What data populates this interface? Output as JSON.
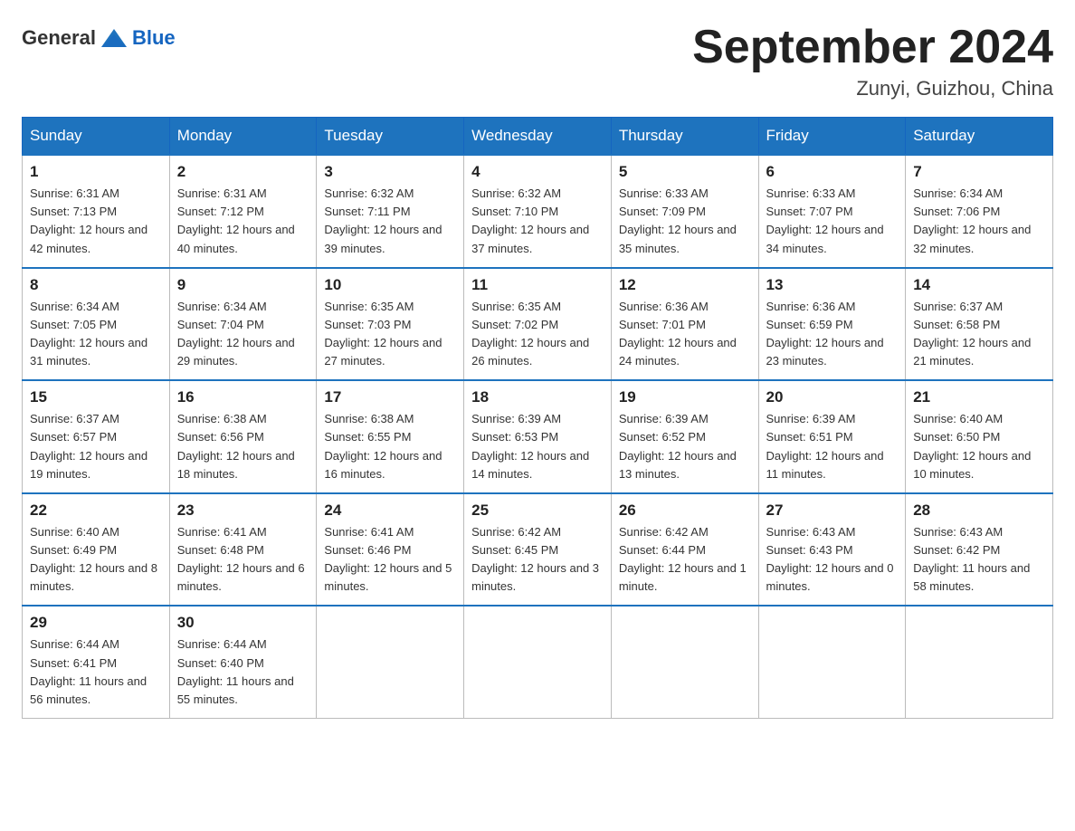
{
  "header": {
    "logo_general": "General",
    "logo_blue": "Blue",
    "title": "September 2024",
    "location": "Zunyi, Guizhou, China"
  },
  "days_of_week": [
    "Sunday",
    "Monday",
    "Tuesday",
    "Wednesday",
    "Thursday",
    "Friday",
    "Saturday"
  ],
  "weeks": [
    [
      {
        "day": "1",
        "sunrise": "6:31 AM",
        "sunset": "7:13 PM",
        "daylight": "12 hours and 42 minutes."
      },
      {
        "day": "2",
        "sunrise": "6:31 AM",
        "sunset": "7:12 PM",
        "daylight": "12 hours and 40 minutes."
      },
      {
        "day": "3",
        "sunrise": "6:32 AM",
        "sunset": "7:11 PM",
        "daylight": "12 hours and 39 minutes."
      },
      {
        "day": "4",
        "sunrise": "6:32 AM",
        "sunset": "7:10 PM",
        "daylight": "12 hours and 37 minutes."
      },
      {
        "day": "5",
        "sunrise": "6:33 AM",
        "sunset": "7:09 PM",
        "daylight": "12 hours and 35 minutes."
      },
      {
        "day": "6",
        "sunrise": "6:33 AM",
        "sunset": "7:07 PM",
        "daylight": "12 hours and 34 minutes."
      },
      {
        "day": "7",
        "sunrise": "6:34 AM",
        "sunset": "7:06 PM",
        "daylight": "12 hours and 32 minutes."
      }
    ],
    [
      {
        "day": "8",
        "sunrise": "6:34 AM",
        "sunset": "7:05 PM",
        "daylight": "12 hours and 31 minutes."
      },
      {
        "day": "9",
        "sunrise": "6:34 AM",
        "sunset": "7:04 PM",
        "daylight": "12 hours and 29 minutes."
      },
      {
        "day": "10",
        "sunrise": "6:35 AM",
        "sunset": "7:03 PM",
        "daylight": "12 hours and 27 minutes."
      },
      {
        "day": "11",
        "sunrise": "6:35 AM",
        "sunset": "7:02 PM",
        "daylight": "12 hours and 26 minutes."
      },
      {
        "day": "12",
        "sunrise": "6:36 AM",
        "sunset": "7:01 PM",
        "daylight": "12 hours and 24 minutes."
      },
      {
        "day": "13",
        "sunrise": "6:36 AM",
        "sunset": "6:59 PM",
        "daylight": "12 hours and 23 minutes."
      },
      {
        "day": "14",
        "sunrise": "6:37 AM",
        "sunset": "6:58 PM",
        "daylight": "12 hours and 21 minutes."
      }
    ],
    [
      {
        "day": "15",
        "sunrise": "6:37 AM",
        "sunset": "6:57 PM",
        "daylight": "12 hours and 19 minutes."
      },
      {
        "day": "16",
        "sunrise": "6:38 AM",
        "sunset": "6:56 PM",
        "daylight": "12 hours and 18 minutes."
      },
      {
        "day": "17",
        "sunrise": "6:38 AM",
        "sunset": "6:55 PM",
        "daylight": "12 hours and 16 minutes."
      },
      {
        "day": "18",
        "sunrise": "6:39 AM",
        "sunset": "6:53 PM",
        "daylight": "12 hours and 14 minutes."
      },
      {
        "day": "19",
        "sunrise": "6:39 AM",
        "sunset": "6:52 PM",
        "daylight": "12 hours and 13 minutes."
      },
      {
        "day": "20",
        "sunrise": "6:39 AM",
        "sunset": "6:51 PM",
        "daylight": "12 hours and 11 minutes."
      },
      {
        "day": "21",
        "sunrise": "6:40 AM",
        "sunset": "6:50 PM",
        "daylight": "12 hours and 10 minutes."
      }
    ],
    [
      {
        "day": "22",
        "sunrise": "6:40 AM",
        "sunset": "6:49 PM",
        "daylight": "12 hours and 8 minutes."
      },
      {
        "day": "23",
        "sunrise": "6:41 AM",
        "sunset": "6:48 PM",
        "daylight": "12 hours and 6 minutes."
      },
      {
        "day": "24",
        "sunrise": "6:41 AM",
        "sunset": "6:46 PM",
        "daylight": "12 hours and 5 minutes."
      },
      {
        "day": "25",
        "sunrise": "6:42 AM",
        "sunset": "6:45 PM",
        "daylight": "12 hours and 3 minutes."
      },
      {
        "day": "26",
        "sunrise": "6:42 AM",
        "sunset": "6:44 PM",
        "daylight": "12 hours and 1 minute."
      },
      {
        "day": "27",
        "sunrise": "6:43 AM",
        "sunset": "6:43 PM",
        "daylight": "12 hours and 0 minutes."
      },
      {
        "day": "28",
        "sunrise": "6:43 AM",
        "sunset": "6:42 PM",
        "daylight": "11 hours and 58 minutes."
      }
    ],
    [
      {
        "day": "29",
        "sunrise": "6:44 AM",
        "sunset": "6:41 PM",
        "daylight": "11 hours and 56 minutes."
      },
      {
        "day": "30",
        "sunrise": "6:44 AM",
        "sunset": "6:40 PM",
        "daylight": "11 hours and 55 minutes."
      },
      null,
      null,
      null,
      null,
      null
    ]
  ]
}
